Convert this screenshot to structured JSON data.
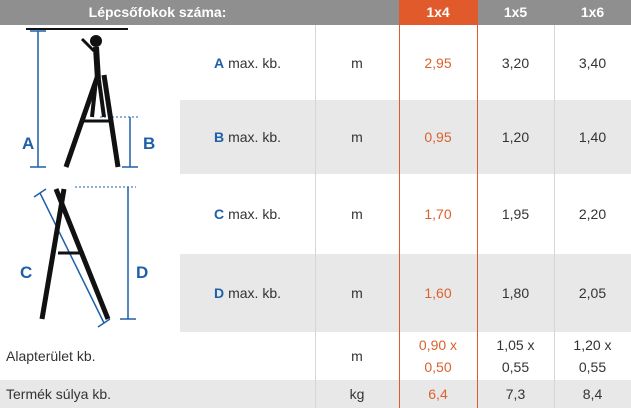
{
  "header": {
    "title": "Lépcsőfokok száma:",
    "columns": [
      "1x4",
      "1x5",
      "1x6"
    ]
  },
  "rows": [
    {
      "letter": "A",
      "label": "max. kb.",
      "unit": "m",
      "values": [
        "2,95",
        "3,20",
        "3,40"
      ]
    },
    {
      "letter": "B",
      "label": "max. kb.",
      "unit": "m",
      "values": [
        "0,95",
        "1,20",
        "1,40"
      ]
    },
    {
      "letter": "C",
      "label": "max. kb.",
      "unit": "m",
      "values": [
        "1,70",
        "1,95",
        "2,20"
      ]
    },
    {
      "letter": "D",
      "label": "max. kb.",
      "unit": "m",
      "values": [
        "1,60",
        "1,80",
        "2,05"
      ]
    }
  ],
  "footprint": {
    "label": "Alapterület kb.",
    "unit": "m",
    "values": [
      [
        "0,90 x",
        "0,50"
      ],
      [
        "1,05 x",
        "0,55"
      ],
      [
        "1,20 x",
        "0,55"
      ]
    ]
  },
  "weight": {
    "label": "Termék súlya kb.",
    "unit": "kg",
    "values": [
      "6,4",
      "7,3",
      "8,4"
    ]
  },
  "diagram_labels": [
    "A",
    "B",
    "C",
    "D"
  ],
  "colors": {
    "accent": "#e05a2b",
    "letter_blue": "#1f5fa8",
    "header_grey": "#8f8f8f",
    "row_grey": "#e8e8e8"
  }
}
